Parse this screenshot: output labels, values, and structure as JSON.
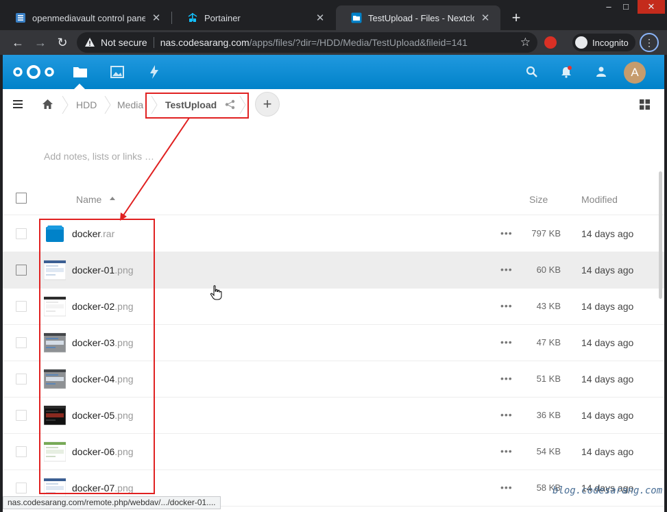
{
  "browser": {
    "tabs": [
      {
        "title": "openmediavault control panel - c",
        "icon": "omv-icon",
        "active": false
      },
      {
        "title": "Portainer",
        "icon": "portainer-icon",
        "active": false
      },
      {
        "title": "TestUpload - Files - Nextcloud",
        "icon": "nextcloud-folder-icon",
        "active": true
      }
    ],
    "new_tab": "+",
    "window_controls": [
      "–",
      "□",
      "✕"
    ],
    "security_label": "Not secure",
    "url_host": "nas.codesarang.com",
    "url_path": "/apps/files/?dir=/HDD/Media/TestUpload&fileid=141",
    "incognito_label": "Incognito"
  },
  "nextcloud": {
    "header_icons": [
      "files-icon",
      "photos-icon",
      "activity-icon",
      "search-icon",
      "notifications-icon",
      "contacts-icon"
    ],
    "avatar_letter": "A",
    "accent_color": "#0082c9",
    "breadcrumb": {
      "items": [
        "HDD",
        "Media"
      ],
      "current": "TestUpload"
    },
    "add_button": "+",
    "notes_placeholder": "Add notes, lists or links …",
    "table": {
      "columns": {
        "name": "Name",
        "size": "Size",
        "modified": "Modified"
      },
      "rows": [
        {
          "base": "docker",
          "ext": ".rar",
          "size": "797 KB",
          "modified": "14 days ago",
          "type": "archive"
        },
        {
          "base": "docker-01",
          "ext": ".png",
          "size": "60 KB",
          "modified": "14 days ago",
          "type": "image-light"
        },
        {
          "base": "docker-02",
          "ext": ".png",
          "size": "43 KB",
          "modified": "14 days ago",
          "type": "image-white"
        },
        {
          "base": "docker-03",
          "ext": ".png",
          "size": "47 KB",
          "modified": "14 days ago",
          "type": "image-grey"
        },
        {
          "base": "docker-04",
          "ext": ".png",
          "size": "51 KB",
          "modified": "14 days ago",
          "type": "image-grey"
        },
        {
          "base": "docker-05",
          "ext": ".png",
          "size": "36 KB",
          "modified": "14 days ago",
          "type": "image-dark"
        },
        {
          "base": "docker-06",
          "ext": ".png",
          "size": "54 KB",
          "modified": "14 days ago",
          "type": "image-green"
        },
        {
          "base": "docker-07",
          "ext": ".png",
          "size": "58 KB",
          "modified": "14 days ago",
          "type": "image-light"
        }
      ],
      "row_actions": "•••"
    }
  },
  "status_url": "nas.codesarang.com/remote.php/webdav/.../docker-01....",
  "watermark": "blog.codesarang.com",
  "annotation_color": "#e02020"
}
